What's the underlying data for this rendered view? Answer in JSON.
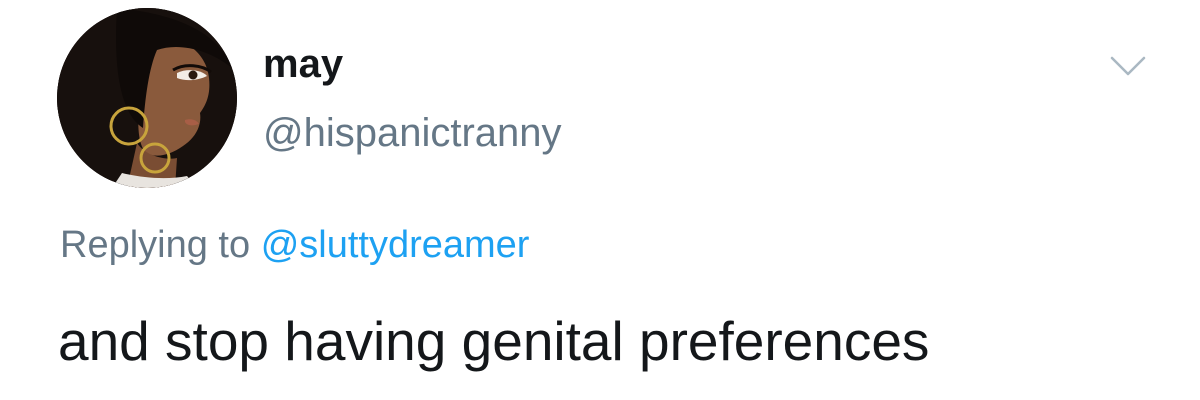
{
  "tweet": {
    "author": {
      "display_name": "may",
      "handle": "@hispanictranny"
    },
    "reply": {
      "prefix": "Replying to",
      "mention": "@sluttydreamer"
    },
    "text": "and stop having genital preferences",
    "icons": {
      "avatar": "avatar-image",
      "menu": "chevron-down-icon"
    },
    "colors": {
      "text": "#14171a",
      "secondary": "#657786",
      "link": "#1da1f2",
      "caret": "#aab8c2"
    }
  }
}
